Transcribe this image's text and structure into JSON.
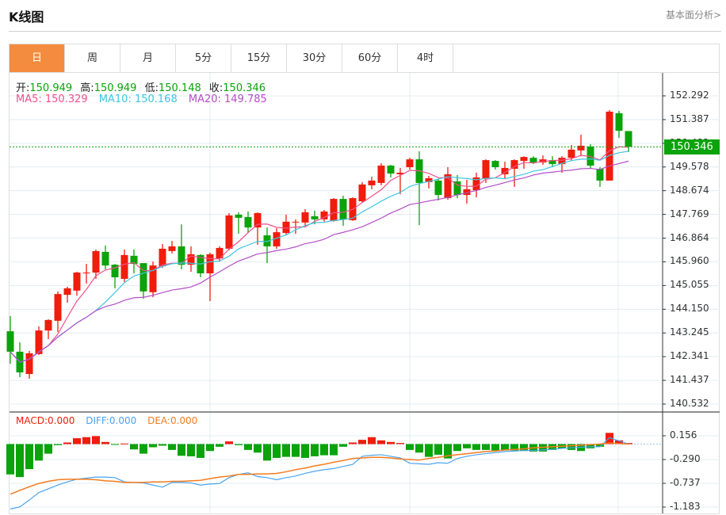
{
  "header": {
    "title": "K线图",
    "fundamental_link": "基本面分析>"
  },
  "tabs": [
    {
      "label": "日",
      "active": true
    },
    {
      "label": "周"
    },
    {
      "label": "月"
    },
    {
      "label": "5分"
    },
    {
      "label": "15分"
    },
    {
      "label": "30分"
    },
    {
      "label": "60分"
    },
    {
      "label": "4时"
    }
  ],
  "ohlc_info": {
    "open_label": "开:",
    "open": "150.949",
    "high_label": "高:",
    "high": "150.949",
    "low_label": "低:",
    "low": "150.148",
    "close_label": "收:",
    "close": "150.346"
  },
  "ma_info": {
    "ma5": "MA5: 150.329",
    "ma10": "MA10: 150.168",
    "ma20": "MA20: 149.785"
  },
  "macd_info": {
    "macd": "MACD:0.000",
    "diff": "DIFF:0.000",
    "dea": "DEA:0.000"
  },
  "current_price": "150.346",
  "colors": {
    "up": "#f01c0c",
    "down": "#0aa30a",
    "ma5": "#f0508a",
    "ma10": "#3ec6e0",
    "ma20": "#b44ec8",
    "diff": "#4aa3f0",
    "dea": "#f57c1f",
    "active_tab": "#f48c3f"
  },
  "chart_data": [
    {
      "type": "candlestick",
      "ylim": [
        140.532,
        152.292
      ],
      "y_ticks": [
        "152.292",
        "151.387",
        "150.482",
        "149.578",
        "148.674",
        "147.769",
        "146.864",
        "145.960",
        "145.055",
        "144.150",
        "143.245",
        "142.341",
        "141.437",
        "140.532"
      ],
      "grid": true,
      "ohlc": [
        [
          143.31,
          143.89,
          142.07,
          142.53
        ],
        [
          142.53,
          142.89,
          141.56,
          141.74
        ],
        [
          141.68,
          142.56,
          141.5,
          142.47
        ],
        [
          142.44,
          143.5,
          142.41,
          143.34
        ],
        [
          143.34,
          143.77,
          143.01,
          143.74
        ],
        [
          143.71,
          144.83,
          143.28,
          144.73
        ],
        [
          144.7,
          145.01,
          144.4,
          144.95
        ],
        [
          144.86,
          145.58,
          144.67,
          145.55
        ],
        [
          145.53,
          145.88,
          145.13,
          145.55
        ],
        [
          145.55,
          146.43,
          145.31,
          146.37
        ],
        [
          146.34,
          146.58,
          145.67,
          145.82
        ],
        [
          145.85,
          145.88,
          144.95,
          145.37
        ],
        [
          145.31,
          146.43,
          145.19,
          146.22
        ],
        [
          146.19,
          146.43,
          145.52,
          145.88
        ],
        [
          145.91,
          145.91,
          144.55,
          144.83
        ],
        [
          144.8,
          145.97,
          144.61,
          145.82
        ],
        [
          145.79,
          146.64,
          145.73,
          146.46
        ],
        [
          146.37,
          146.76,
          146.28,
          146.55
        ],
        [
          146.55,
          147.39,
          145.67,
          145.85
        ],
        [
          145.85,
          146.55,
          145.58,
          146.25
        ],
        [
          146.22,
          146.25,
          145.37,
          145.52
        ],
        [
          145.52,
          146.31,
          144.46,
          146.25
        ],
        [
          146.09,
          146.55,
          145.97,
          146.49
        ],
        [
          146.46,
          147.82,
          146.4,
          147.73
        ],
        [
          147.76,
          147.85,
          147.03,
          147.64
        ],
        [
          147.67,
          147.88,
          147.06,
          147.27
        ],
        [
          147.27,
          147.85,
          146.61,
          147.82
        ],
        [
          146.97,
          147.27,
          145.91,
          146.55
        ],
        [
          146.55,
          147.24,
          146.46,
          147.09
        ],
        [
          147.06,
          147.76,
          147.0,
          147.49
        ],
        [
          147.46,
          147.58,
          147.03,
          147.49
        ],
        [
          147.46,
          147.97,
          147.3,
          147.85
        ],
        [
          147.7,
          147.91,
          147.39,
          147.58
        ],
        [
          147.58,
          147.94,
          147.49,
          147.88
        ],
        [
          147.52,
          148.39,
          147.49,
          148.36
        ],
        [
          148.36,
          148.48,
          147.33,
          147.58
        ],
        [
          147.55,
          148.42,
          147.52,
          148.39
        ],
        [
          148.27,
          149.0,
          148.21,
          148.91
        ],
        [
          148.88,
          149.21,
          148.73,
          149.06
        ],
        [
          148.97,
          149.72,
          148.88,
          149.63
        ],
        [
          149.63,
          149.66,
          149.18,
          149.33
        ],
        [
          149.3,
          149.54,
          148.54,
          149.36
        ],
        [
          149.57,
          149.93,
          149.48,
          149.87
        ],
        [
          149.87,
          150.18,
          147.36,
          148.97
        ],
        [
          149.0,
          149.24,
          148.76,
          149.15
        ],
        [
          149.06,
          149.12,
          148.3,
          148.51
        ],
        [
          148.39,
          149.57,
          148.33,
          149.3
        ],
        [
          149.03,
          149.27,
          148.39,
          148.51
        ],
        [
          148.51,
          149.09,
          148.18,
          148.73
        ],
        [
          148.69,
          149.36,
          148.42,
          149.18
        ],
        [
          149.12,
          149.87,
          148.97,
          149.84
        ],
        [
          149.81,
          149.84,
          149.48,
          149.57
        ],
        [
          149.3,
          149.78,
          149.12,
          149.54
        ],
        [
          149.51,
          149.87,
          148.82,
          149.84
        ],
        [
          149.81,
          149.99,
          149.51,
          149.96
        ],
        [
          149.93,
          149.99,
          149.69,
          149.75
        ],
        [
          149.75,
          150.02,
          149.66,
          149.87
        ],
        [
          149.84,
          149.99,
          149.57,
          149.69
        ],
        [
          149.69,
          149.99,
          149.36,
          149.93
        ],
        [
          149.93,
          150.42,
          149.81,
          150.24
        ],
        [
          150.21,
          150.81,
          149.99,
          150.39
        ],
        [
          150.36,
          150.45,
          149.51,
          149.63
        ],
        [
          149.51,
          149.57,
          148.82,
          149.06
        ],
        [
          149.06,
          151.75,
          149.06,
          151.69
        ],
        [
          151.63,
          151.72,
          150.69,
          150.96
        ],
        [
          150.949,
          150.949,
          150.148,
          150.346
        ]
      ],
      "moving_averages": [
        "MA5",
        "MA10",
        "MA20"
      ]
    },
    {
      "type": "macd",
      "ylim": [
        -1.183,
        0.156
      ],
      "y_ticks": [
        "0.156",
        "-0.290",
        "-0.737",
        "-1.183"
      ],
      "histogram": [
        -0.57,
        -0.62,
        -0.47,
        -0.31,
        -0.18,
        -0.02,
        0.03,
        0.11,
        0.13,
        0.15,
        0.04,
        -0.01,
        0.01,
        -0.1,
        -0.18,
        -0.06,
        -0.03,
        -0.11,
        -0.22,
        -0.23,
        -0.26,
        -0.13,
        -0.05,
        0.05,
        -0.02,
        -0.11,
        -0.16,
        -0.31,
        -0.26,
        -0.24,
        -0.24,
        -0.26,
        -0.23,
        -0.21,
        -0.21,
        -0.05,
        0.03,
        0.08,
        0.13,
        0.07,
        0.04,
        0.02,
        -0.11,
        -0.16,
        -0.24,
        -0.2,
        -0.27,
        -0.13,
        -0.08,
        -0.11,
        -0.11,
        -0.12,
        -0.12,
        -0.12,
        -0.13,
        -0.14,
        -0.14,
        -0.11,
        -0.08,
        -0.11,
        -0.13,
        -0.08,
        -0.05,
        0.21,
        0.07,
        0.02
      ],
      "diff": [
        -1.22,
        -1.18,
        -1.05,
        -0.91,
        -0.84,
        -0.77,
        -0.71,
        -0.66,
        -0.64,
        -0.62,
        -0.62,
        -0.63,
        -0.71,
        -0.72,
        -0.73,
        -0.77,
        -0.81,
        -0.72,
        -0.72,
        -0.73,
        -0.77,
        -0.75,
        -0.74,
        -0.63,
        -0.57,
        -0.54,
        -0.61,
        -0.63,
        -0.67,
        -0.63,
        -0.6,
        -0.55,
        -0.51,
        -0.48,
        -0.46,
        -0.42,
        -0.38,
        -0.23,
        -0.21,
        -0.2,
        -0.23,
        -0.26,
        -0.36,
        -0.37,
        -0.38,
        -0.35,
        -0.36,
        -0.27,
        -0.23,
        -0.2,
        -0.18,
        -0.16,
        -0.14,
        -0.13,
        -0.12,
        -0.12,
        -0.11,
        -0.1,
        -0.08,
        -0.07,
        -0.06,
        -0.05,
        -0.05,
        0.12,
        0.06,
        0.0
      ],
      "dea": [
        -0.94,
        -0.87,
        -0.8,
        -0.74,
        -0.7,
        -0.67,
        -0.66,
        -0.66,
        -0.66,
        -0.67,
        -0.69,
        -0.7,
        -0.72,
        -0.72,
        -0.72,
        -0.71,
        -0.71,
        -0.7,
        -0.7,
        -0.69,
        -0.68,
        -0.65,
        -0.62,
        -0.6,
        -0.57,
        -0.57,
        -0.56,
        -0.56,
        -0.55,
        -0.52,
        -0.48,
        -0.45,
        -0.41,
        -0.38,
        -0.34,
        -0.31,
        -0.27,
        -0.26,
        -0.25,
        -0.25,
        -0.26,
        -0.28,
        -0.29,
        -0.3,
        -0.27,
        -0.25,
        -0.22,
        -0.2,
        -0.18,
        -0.16,
        -0.14,
        -0.13,
        -0.11,
        -0.1,
        -0.09,
        -0.07,
        -0.06,
        -0.05,
        -0.04,
        -0.03,
        -0.02,
        -0.01,
        0.0,
        0.02,
        0.01,
        0.0
      ]
    }
  ]
}
